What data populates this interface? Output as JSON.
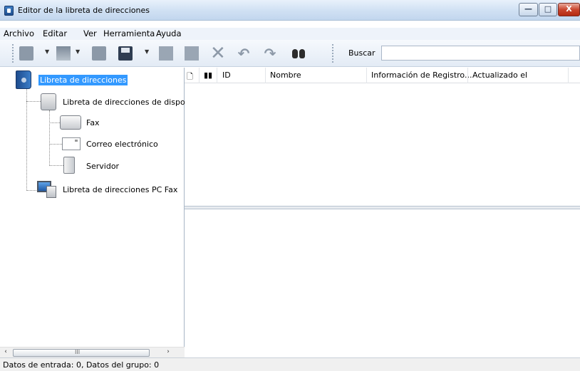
{
  "window": {
    "title": "Editor de la libreta de direcciones",
    "controls": {
      "minimize": "—",
      "maximize": "□",
      "close": "X"
    }
  },
  "menu": {
    "items": [
      "Archivo",
      "Editar",
      "Ver",
      "Herramienta",
      "Ayuda"
    ]
  },
  "toolbar": {
    "search_label": "Buscar",
    "search_value": ""
  },
  "tree": {
    "root": "Libreta de direcciones",
    "device_book": "Libreta de direcciones de disposit",
    "fax": "Fax",
    "email": "Correo electrónico",
    "server": "Servidor",
    "pcfax_book": "Libreta de direcciones PC Fax"
  },
  "list": {
    "columns": [
      "ID",
      "Nombre",
      "Información de Registro...",
      "Actualizado el"
    ]
  },
  "scrollbar": {
    "left_arrow": "‹",
    "right_arrow": "›",
    "grip": "III"
  },
  "status": {
    "text": "Datos de entrada: 0, Datos del grupo: 0"
  }
}
